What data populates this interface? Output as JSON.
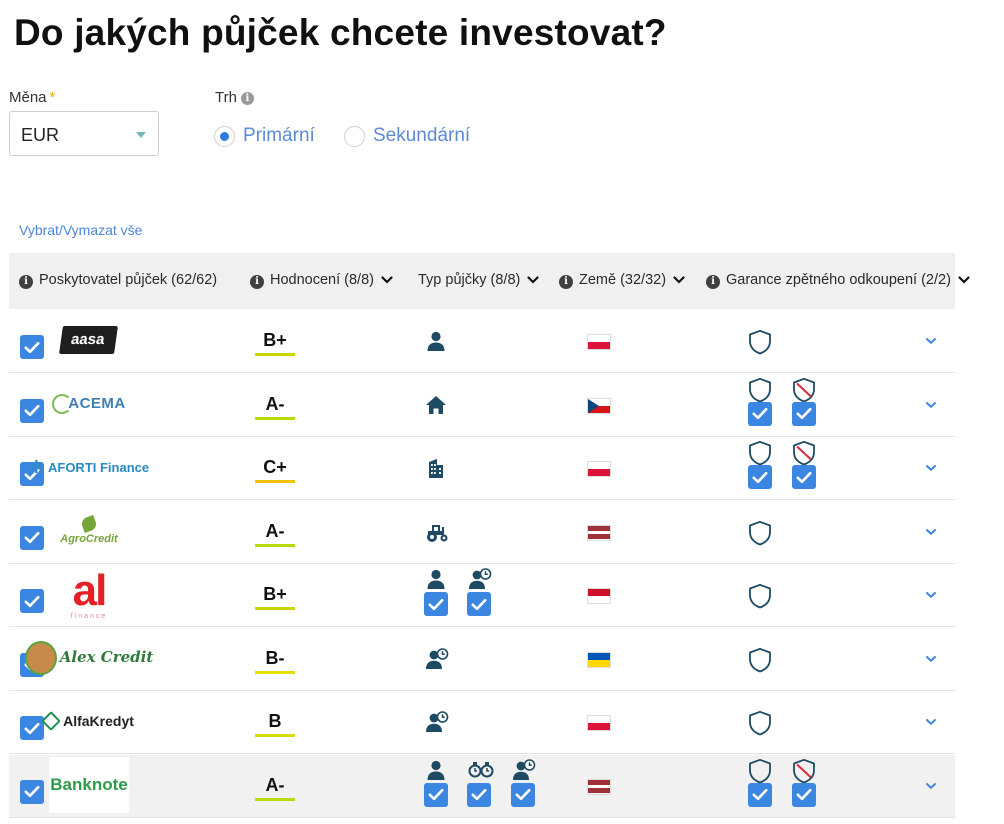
{
  "page": {
    "title": "Do jakých půjček chcete investovat?"
  },
  "currency": {
    "label": "Měna",
    "required_mark": "*",
    "value": "EUR"
  },
  "market": {
    "label": "Trh",
    "info_icon": "info-icon",
    "options": [
      {
        "label": "Primární",
        "selected": true
      },
      {
        "label": "Sekundární",
        "selected": false
      }
    ]
  },
  "select_all": "Vybrat/Vymazat vše",
  "table": {
    "headers": {
      "provider": "Poskytovatel půjček (62/62)",
      "rating": "Hodnocení (8/8)",
      "type": "Typ půjčky (8/8)",
      "country": "Země (32/32)",
      "guarantee": "Garance zpětného odkoupení (2/2)"
    },
    "rows": [
      {
        "logo_text": "aasa",
        "grade": "B+",
        "grade_color": "#c9d600",
        "types": [
          "person-icon"
        ],
        "country": "Poland",
        "guarantees": [
          "shield-icon"
        ],
        "checked": true
      },
      {
        "logo_text": "ACEMA",
        "grade": "A-",
        "grade_color": "#b5dc00",
        "types": [
          "house-icon"
        ],
        "country": "Czech Republic",
        "guarantees": [
          "shield-icon",
          "shield-crossed-icon"
        ],
        "checked": true
      },
      {
        "logo_text": "AFORTI Finance",
        "grade": "C+",
        "grade_color": "#f2c200",
        "types": [
          "building-icon"
        ],
        "country": "Poland",
        "guarantees": [
          "shield-icon",
          "shield-crossed-icon"
        ],
        "checked": true
      },
      {
        "logo_text": "AgroCredit",
        "grade": "A-",
        "grade_color": "#b5dc00",
        "types": [
          "tractor-icon"
        ],
        "country": "Latvia",
        "guarantees": [
          "shield-icon"
        ],
        "checked": true
      },
      {
        "logo_text": "al",
        "logo_sub": "finance",
        "grade": "B+",
        "grade_color": "#c9d600",
        "types": [
          "person-icon",
          "person-clock-icon"
        ],
        "country": "Indonesia",
        "guarantees": [
          "shield-icon"
        ],
        "checked": true
      },
      {
        "logo_text": "Alex Credit",
        "grade": "B-",
        "grade_color": "#e3e000",
        "types": [
          "person-clock-icon"
        ],
        "country": "Ukraine",
        "guarantees": [
          "shield-icon"
        ],
        "checked": true
      },
      {
        "logo_text": "AlfaKredyt",
        "grade": "B",
        "grade_color": "#d6dc00",
        "types": [
          "person-clock-icon"
        ],
        "country": "Poland",
        "guarantees": [
          "shield-icon"
        ],
        "checked": true
      },
      {
        "logo_text": "Banknote",
        "grade": "A-",
        "grade_color": "#b5dc00",
        "types": [
          "person-icon",
          "watch-icon",
          "person-clock-icon"
        ],
        "country": "Latvia",
        "guarantees": [
          "shield-icon",
          "shield-crossed-icon"
        ],
        "checked": true
      }
    ]
  },
  "colors": {
    "accent_blue": "#3b86e0",
    "icon_dark": "#1e4a63",
    "link_blue": "#4f86d6"
  }
}
